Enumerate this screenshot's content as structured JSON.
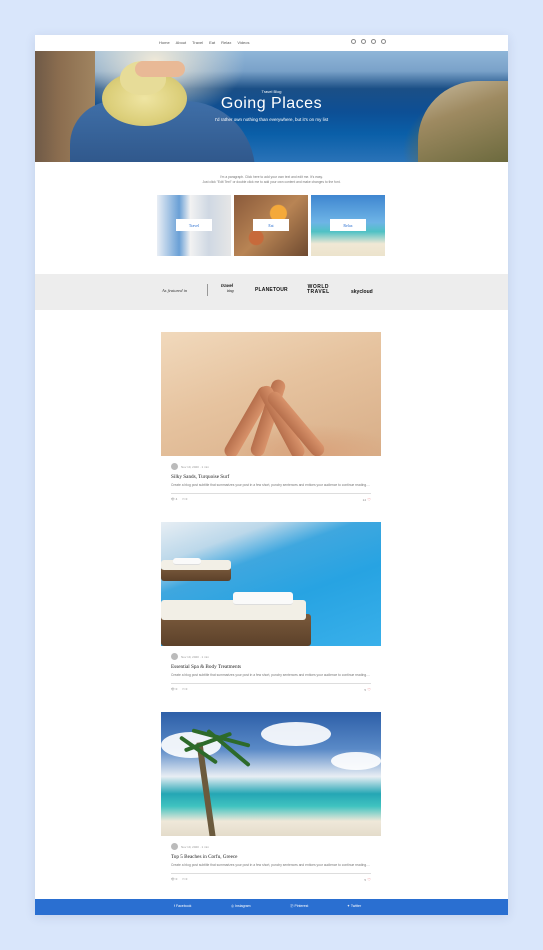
{
  "nav": {
    "links": [
      "Home",
      "About",
      "Travel",
      "Eat",
      "Relax",
      "Videos"
    ],
    "social_icons": [
      "facebook-icon",
      "instagram-icon",
      "pinterest-icon",
      "twitter-icon"
    ]
  },
  "hero": {
    "kicker": "Travel Blog",
    "title": "Going Places",
    "subtitle": "I'd rather own nothing than everywhere, but it's on my list"
  },
  "intro": {
    "line1": "I'm a paragraph. Click here to add your own text and edit me. It's easy.",
    "line2": "Just click \"Edit Text\" or double click me to add your own content and make changes to the font."
  },
  "categories": [
    {
      "label": "Travel"
    },
    {
      "label": "Eat"
    },
    {
      "label": "Relax"
    }
  ],
  "featured": {
    "label": "As featured in",
    "logos": [
      "travel blog",
      "PLANETOUR",
      "WORLD TRAVEL",
      "skycloud"
    ]
  },
  "posts": [
    {
      "date": "Nov 19, 2020",
      "read": "1 min",
      "title": "Silky Sands, Turquoise Surf",
      "desc": "Create a blog post subtitle that summarizes your post in a few short, punchy sentences and entices your audience to continue reading....",
      "views": "4",
      "comments": "0",
      "likes": "14"
    },
    {
      "date": "Nov 19, 2020",
      "read": "1 min",
      "title": "Essential Spa & Body Treatments",
      "desc": "Create a blog post subtitle that summarizes your post in a few short, punchy sentences and entices your audience to continue reading....",
      "views": "0",
      "comments": "0",
      "likes": "5"
    },
    {
      "date": "Nov 19, 2020",
      "read": "1 min",
      "title": "Top 5 Beaches in Corfu, Greece",
      "desc": "Create a blog post subtitle that summarizes your post in a few short, punchy sentences and entices your audience to continue reading....",
      "views": "0",
      "comments": "0",
      "likes": "5"
    }
  ],
  "footer": {
    "links": [
      "Facebook",
      "Instagram",
      "Pinterest",
      "Twitter"
    ]
  },
  "colors": {
    "accent": "#2a6fd1",
    "like": "#e0464e",
    "background": "#d9e6fb"
  }
}
